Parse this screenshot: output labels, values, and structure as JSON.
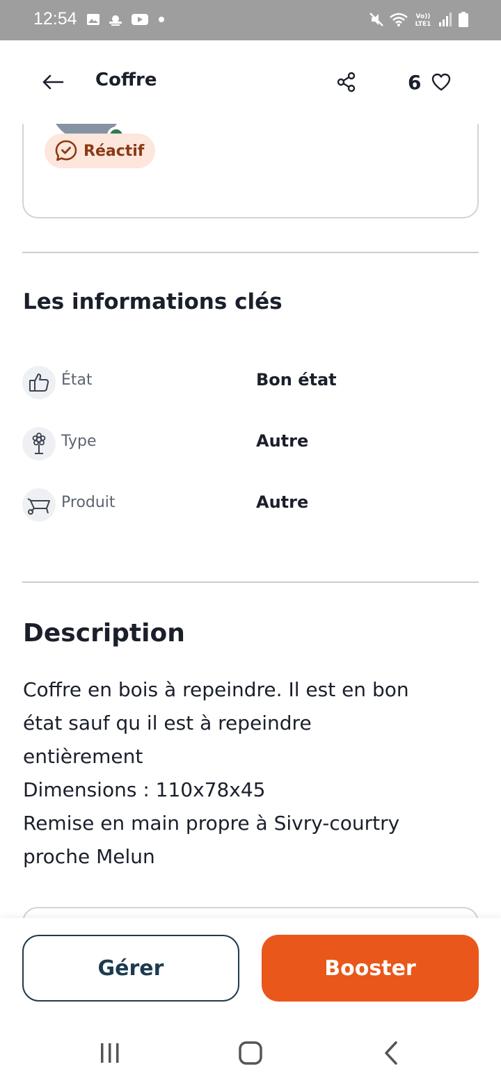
{
  "status_bar": {
    "time": "12:54",
    "left_icons": [
      "gallery-icon",
      "weather-icon",
      "youtube-icon",
      "dot-icon"
    ],
    "right_icons": [
      "mute-icon",
      "wifi-icon",
      "volte-icon",
      "signal-icon",
      "battery-icon"
    ],
    "volte_label": "Vo)) LTE1"
  },
  "header": {
    "title": "Coffre",
    "favorites_count": "6"
  },
  "seller": {
    "badge_label": "Réactif"
  },
  "key_info": {
    "title": "Les informations clés",
    "rows": [
      {
        "icon": "thumbs-up-icon",
        "label": "État",
        "value": "Bon état"
      },
      {
        "icon": "flower-icon",
        "label": "Type",
        "value": "Autre"
      },
      {
        "icon": "wheelbarrow-icon",
        "label": "Produit",
        "value": "Autre"
      }
    ]
  },
  "description": {
    "title": "Description",
    "lines": [
      "Coffre en bois à repeindre. Il est en bon",
      "état sauf qu il est à repeindre",
      "entièrement",
      "Dimensions : 110x78x45",
      "Remise en main propre à Sivry-courtry",
      "proche Melun"
    ]
  },
  "actions": {
    "manage_label": "Gérer",
    "boost_label": "Booster"
  },
  "colors": {
    "accent": "#e9571a",
    "primary_dark": "#1d3b4f",
    "badge_bg": "#fde6dc",
    "status_bar": "#9e9e9e"
  }
}
